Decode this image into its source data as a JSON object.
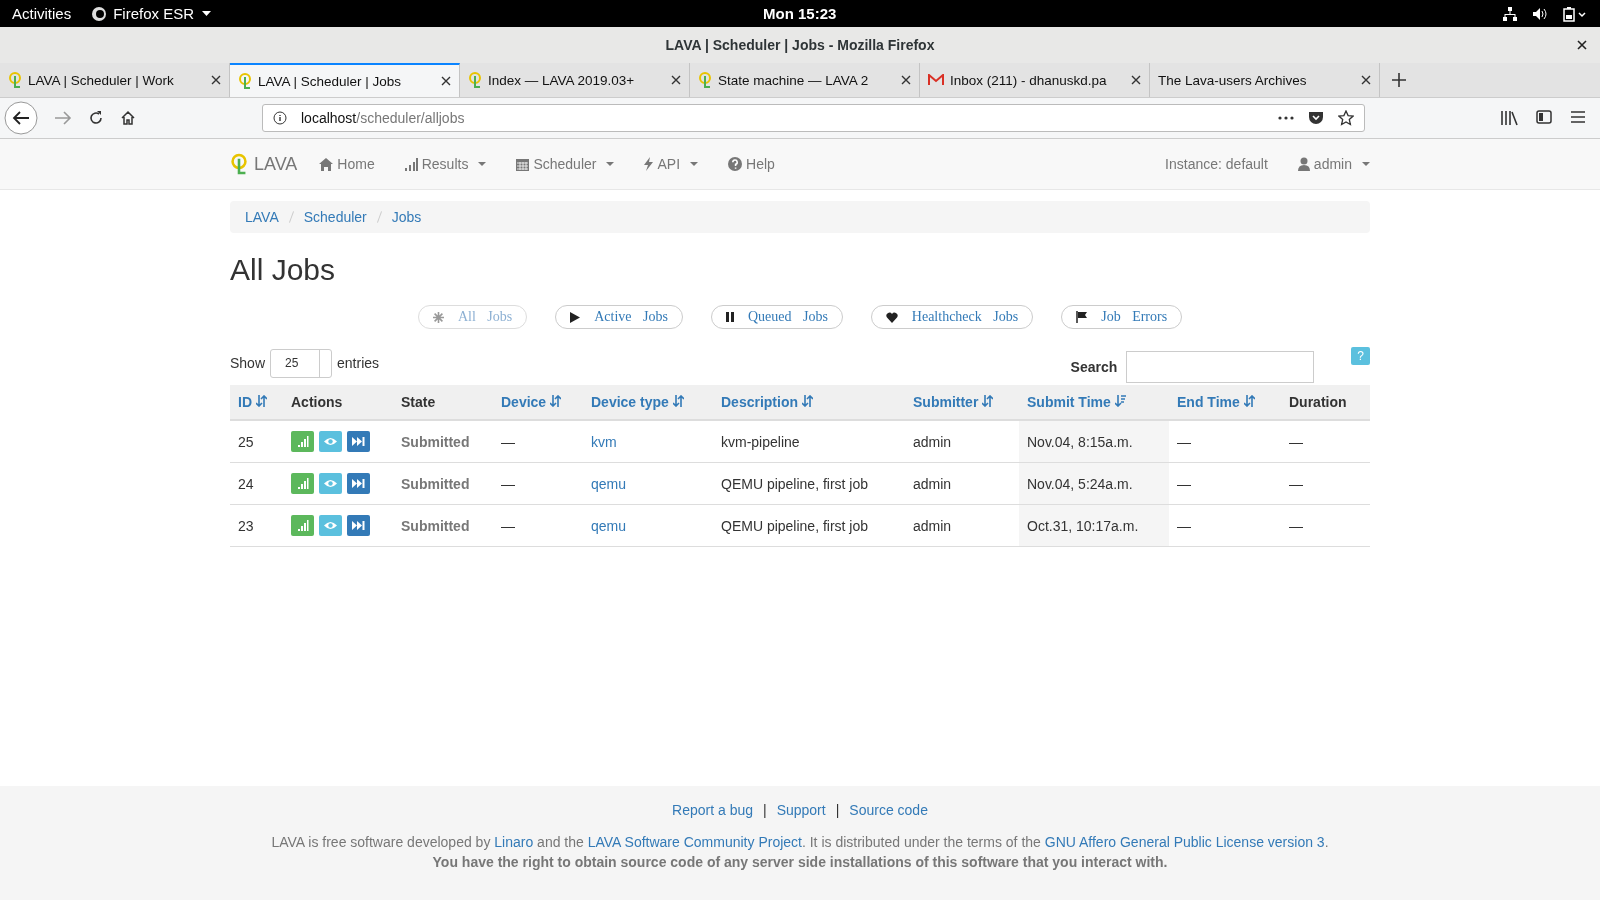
{
  "system_bar": {
    "activities": "Activities",
    "app": "Firefox ESR",
    "clock": "Mon 15:23"
  },
  "window": {
    "title": "LAVA | Scheduler | Jobs - Mozilla Firefox"
  },
  "tabs": [
    {
      "label": "LAVA | Scheduler | Work",
      "kind": "lava",
      "selected": false
    },
    {
      "label": "LAVA | Scheduler | Jobs",
      "kind": "lava",
      "selected": true
    },
    {
      "label": "Index — LAVA 2019.03+",
      "kind": "lava",
      "selected": false
    },
    {
      "label": "State machine — LAVA 2",
      "kind": "lava",
      "selected": false
    },
    {
      "label": "Inbox (211) - dhanuskd.pa",
      "kind": "mail",
      "selected": false
    },
    {
      "label": "The Lava-users Archives",
      "kind": "plain",
      "selected": false
    }
  ],
  "address": {
    "host": "localhost",
    "path": "/scheduler/alljobs"
  },
  "navbar": {
    "brand": "LAVA",
    "items": [
      {
        "label": "Home",
        "kind": "home",
        "dropdown": false
      },
      {
        "label": "Results",
        "kind": "chart",
        "dropdown": true
      },
      {
        "label": "Scheduler",
        "kind": "calendar",
        "dropdown": true
      },
      {
        "label": "API",
        "kind": "bolt",
        "dropdown": true
      },
      {
        "label": "Help",
        "kind": "help",
        "dropdown": false
      }
    ],
    "instance": "Instance: default",
    "user": "admin"
  },
  "breadcrumb": [
    "LAVA",
    "Scheduler",
    "Jobs"
  ],
  "heading": "All Jobs",
  "filters": [
    {
      "label": "All Jobs",
      "kind": "asterisk",
      "selected": true
    },
    {
      "label": "Active Jobs",
      "kind": "play",
      "selected": false
    },
    {
      "label": "Queued Jobs",
      "kind": "pause",
      "selected": false
    },
    {
      "label": "Healthcheck Jobs",
      "kind": "heart",
      "selected": false
    },
    {
      "label": "Job Errors",
      "kind": "flag",
      "selected": false
    }
  ],
  "length": {
    "before": "Show",
    "value": "25",
    "after": "entries"
  },
  "search": {
    "label": "Search"
  },
  "help_button": "?",
  "table": {
    "columns": [
      {
        "label": "ID",
        "sortable": true,
        "sorted": false
      },
      {
        "label": "Actions",
        "sortable": false,
        "sorted": false
      },
      {
        "label": "State",
        "sortable": false,
        "sorted": false
      },
      {
        "label": "Device",
        "sortable": true,
        "sorted": false
      },
      {
        "label": "Device type",
        "sortable": true,
        "sorted": false
      },
      {
        "label": "Description",
        "sortable": true,
        "sorted": false
      },
      {
        "label": "Submitter",
        "sortable": true,
        "sorted": false
      },
      {
        "label": "Submit Time",
        "sortable": true,
        "sorted": true
      },
      {
        "label": "End Time",
        "sortable": true,
        "sorted": false
      },
      {
        "label": "Duration",
        "sortable": false,
        "sorted": false
      }
    ],
    "rows": [
      {
        "id": "25",
        "state": "Submitted",
        "device": "—",
        "device_type": "kvm",
        "description": "kvm-pipeline",
        "submitter": "admin",
        "submit_time": "Nov.04, 8:15a.m.",
        "end_time": "—",
        "duration": "—"
      },
      {
        "id": "24",
        "state": "Submitted",
        "device": "—",
        "device_type": "qemu",
        "description": "QEMU pipeline, first job",
        "submitter": "admin",
        "submit_time": "Nov.04, 5:24a.m.",
        "end_time": "—",
        "duration": "—"
      },
      {
        "id": "23",
        "state": "Submitted",
        "device": "—",
        "device_type": "qemu",
        "description": "QEMU pipeline, first job",
        "submitter": "admin",
        "submit_time": "Oct.31, 10:17a.m.",
        "end_time": "—",
        "duration": "—"
      }
    ]
  },
  "footer": {
    "links": [
      "Report a bug",
      "Support",
      "Source code"
    ],
    "separator": "|",
    "license": [
      {
        "text": "LAVA is free software developed by ",
        "link": false
      },
      {
        "text": "Linaro",
        "link": true
      },
      {
        "text": " and the ",
        "link": false
      },
      {
        "text": "LAVA Software Community Project",
        "link": true
      },
      {
        "text": ". It is distributed under the terms of the ",
        "link": false
      },
      {
        "text": "GNU Affero General Public License version 3",
        "link": true
      },
      {
        "text": ".",
        "link": false
      }
    ],
    "notice": "You have the right to obtain source code of any server side installations of this software that you interact with."
  }
}
